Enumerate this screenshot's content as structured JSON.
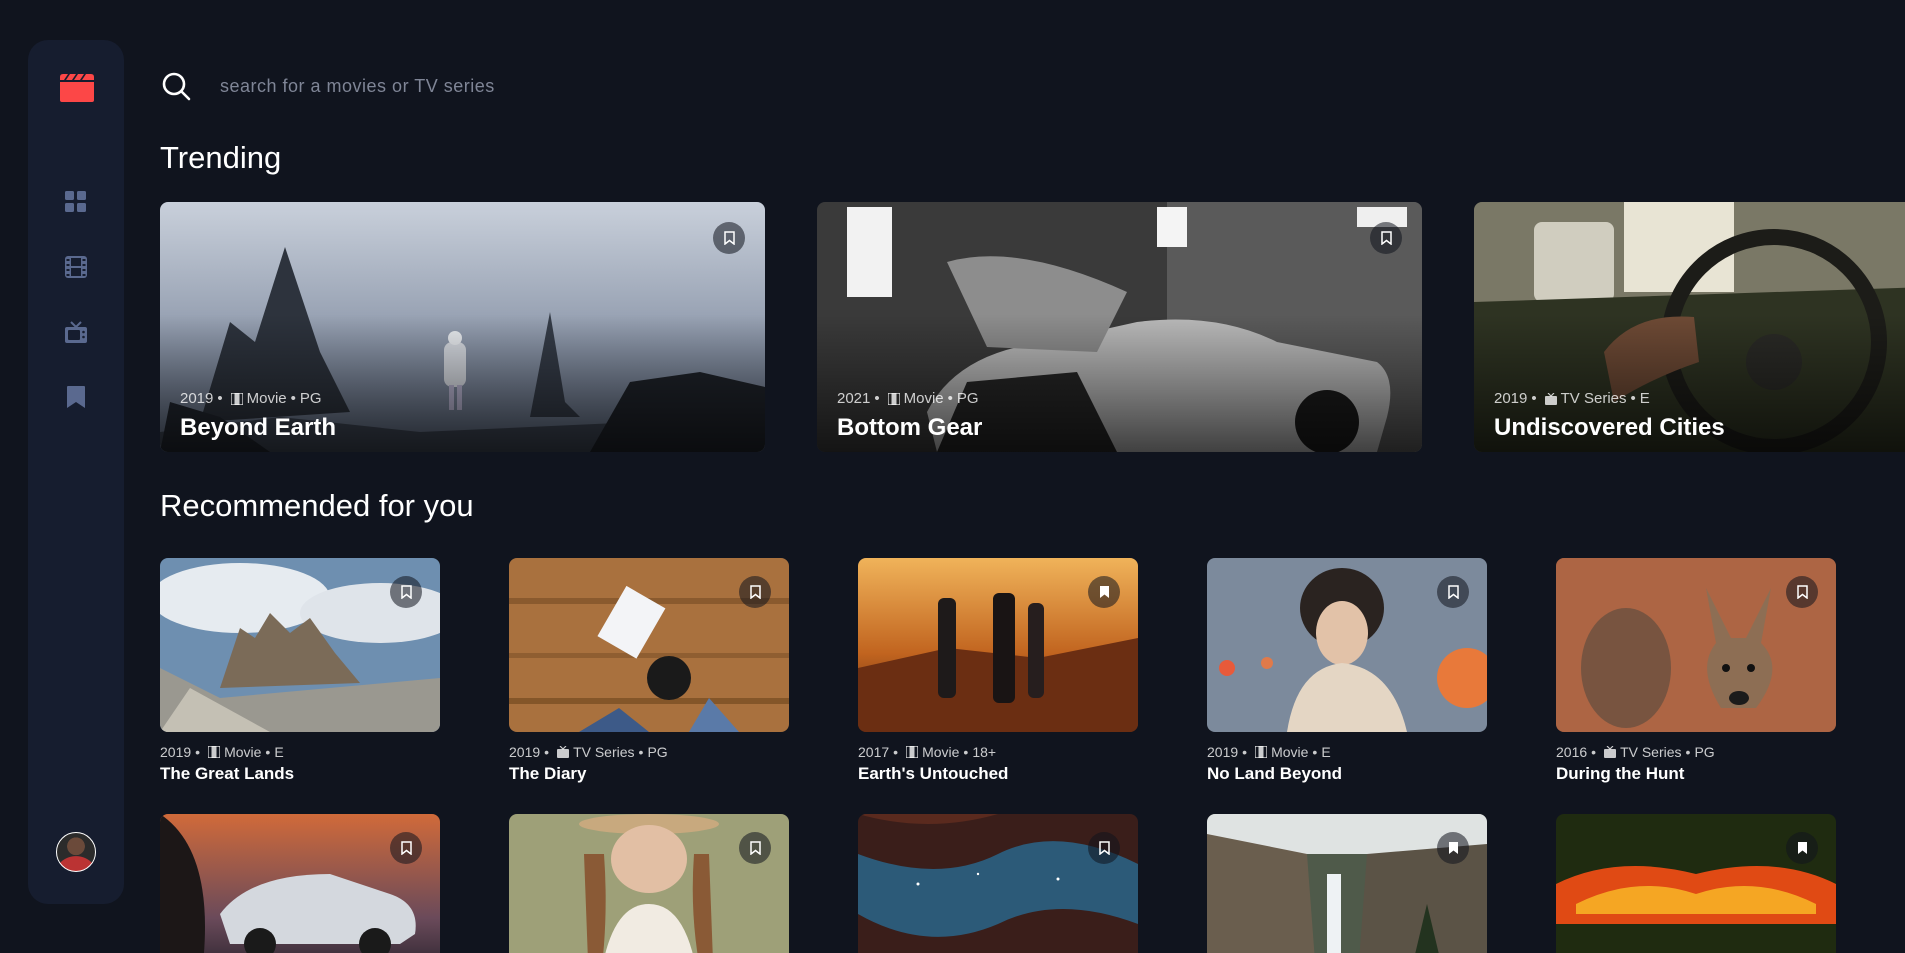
{
  "search": {
    "placeholder": "search for a movies or TV series"
  },
  "sidebar": {
    "logo_icon": "clapperboard-icon",
    "items": [
      {
        "name": "home",
        "icon": "grid-icon"
      },
      {
        "name": "movies",
        "icon": "film-icon"
      },
      {
        "name": "tv-series",
        "icon": "tv-icon"
      },
      {
        "name": "bookmarks",
        "icon": "bookmark-icon"
      }
    ],
    "avatar": "user-avatar"
  },
  "trending": {
    "title": "Trending",
    "items": [
      {
        "year": "2019",
        "category": "Movie",
        "rating": "PG",
        "title": "Beyond Earth"
      },
      {
        "year": "2021",
        "category": "Movie",
        "rating": "PG",
        "title": "Bottom Gear"
      },
      {
        "year": "2019",
        "category": "TV Series",
        "rating": "E",
        "title": "Undiscovered Cities"
      }
    ]
  },
  "recommended": {
    "title": "Recommended for you",
    "items": [
      {
        "year": "2019",
        "category": "Movie",
        "rating": "E",
        "title": "The Great Lands",
        "bookmarked": false
      },
      {
        "year": "2019",
        "category": "TV Series",
        "rating": "PG",
        "title": "The Diary",
        "bookmarked": false
      },
      {
        "year": "2017",
        "category": "Movie",
        "rating": "18+",
        "title": "Earth's Untouched",
        "bookmarked": true
      },
      {
        "year": "2019",
        "category": "Movie",
        "rating": "E",
        "title": "No Land Beyond",
        "bookmarked": false
      },
      {
        "year": "2016",
        "category": "TV Series",
        "rating": "PG",
        "title": "During the Hunt",
        "bookmarked": false
      },
      {
        "bookmarked": false
      },
      {
        "bookmarked": false
      },
      {
        "bookmarked": false
      },
      {
        "bookmarked": true
      },
      {
        "bookmarked": true
      }
    ]
  },
  "colors": {
    "background": "#10141e",
    "sidebar": "#161d2f",
    "accent": "#fc4747",
    "icon": "#5a698f",
    "muted": "#7f8596"
  }
}
